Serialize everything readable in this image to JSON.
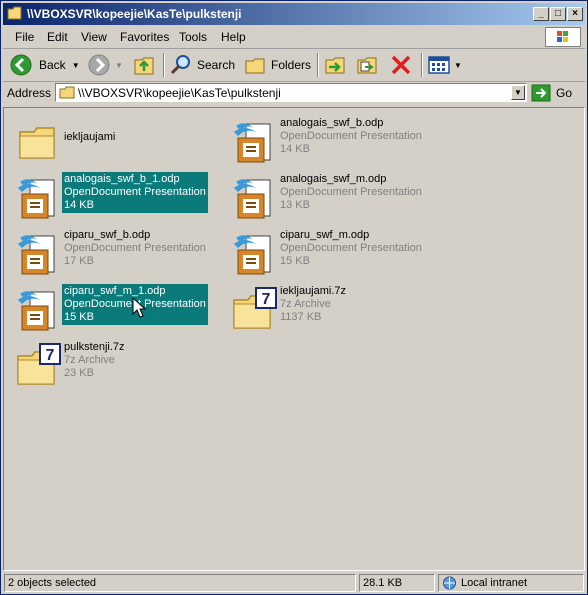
{
  "window": {
    "title": "\\\\VBOXSVR\\kopeejie\\KasTe\\pulkstenji"
  },
  "menu": {
    "items": [
      "File",
      "Edit",
      "View",
      "Favorites",
      "Tools",
      "Help"
    ]
  },
  "toolbar": {
    "back_label": "Back",
    "search_label": "Search",
    "folders_label": "Folders"
  },
  "address": {
    "label": "Address",
    "value": "\\\\VBOXSVR\\kopeejie\\KasTe\\pulkstenji",
    "go_label": "Go"
  },
  "files": [
    {
      "name": "iekljaujami",
      "type": "",
      "size": "",
      "kind": "folder",
      "selected": false
    },
    {
      "name": "analogais_swf_b.odp",
      "type": "OpenDocument Presentation",
      "size": "14 KB",
      "kind": "odp",
      "selected": false
    },
    {
      "name": "analogais_swf_b_1.odp",
      "type": "OpenDocument Presentation",
      "size": "14 KB",
      "kind": "odp",
      "selected": true
    },
    {
      "name": "analogais_swf_m.odp",
      "type": "OpenDocument Presentation",
      "size": "13 KB",
      "kind": "odp",
      "selected": false
    },
    {
      "name": "ciparu_swf_b.odp",
      "type": "OpenDocument Presentation",
      "size": "17 KB",
      "kind": "odp",
      "selected": false
    },
    {
      "name": "ciparu_swf_m.odp",
      "type": "OpenDocument Presentation",
      "size": "15 KB",
      "kind": "odp",
      "selected": false
    },
    {
      "name": "ciparu_swf_m_1.odp",
      "type": "OpenDocument Presentation",
      "size": "15 KB",
      "kind": "odp",
      "selected": true
    },
    {
      "name": "iekljaujami.7z",
      "type": "7z Archive",
      "size": "1137 KB",
      "kind": "7z",
      "selected": false
    },
    {
      "name": "pulkstenji.7z",
      "type": "7z Archive",
      "size": "23 KB",
      "kind": "7z",
      "selected": false
    }
  ],
  "status": {
    "selection": "2 objects selected",
    "size": "28.1 KB",
    "zone": "Local intranet"
  },
  "colors": {
    "title_start": "#0a246a",
    "title_end": "#a6caf0",
    "selection": "#0a7a7a",
    "face": "#d4d0c8"
  }
}
